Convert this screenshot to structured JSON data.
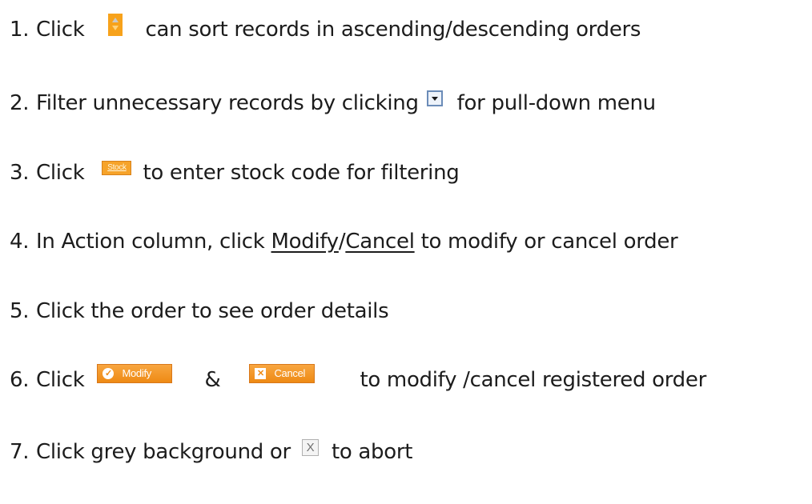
{
  "steps": [
    {
      "number": "1.",
      "text_a": "Click",
      "text_b": "can sort records in ascending/descending orders"
    },
    {
      "number": "2.",
      "text_a": "Filter unnecessary records by clicking",
      "text_b": "for pull-down menu"
    },
    {
      "number": "3.",
      "text_a": "Click",
      "button": "Stock",
      "text_b": "to enter stock code for filtering"
    },
    {
      "number": "4.",
      "text_a": "In Action column, click ",
      "link_modify": "Modify",
      "slash": "/",
      "link_cancel": "Cancel",
      "text_b": " to modify or cancel order"
    },
    {
      "number": "5.",
      "text_a": "Click the order to see order details"
    },
    {
      "number": "6.",
      "text_a": "Click",
      "modify_button": "Modify",
      "amp": "&",
      "cancel_button": "Cancel",
      "text_b": "to modify /cancel registered order"
    },
    {
      "number": "7.",
      "text_a": "Click grey background or",
      "close_glyph": "X",
      "text_b": "to abort"
    }
  ],
  "icons": {
    "sort": "sort-arrows-icon",
    "dropdown": "dropdown-arrow-icon",
    "modify": "check-circle-icon",
    "cancel": "close-box-icon",
    "close": "close-icon"
  },
  "colors": {
    "accent_orange": "#f6a32a",
    "text": "#1c1c1c"
  }
}
